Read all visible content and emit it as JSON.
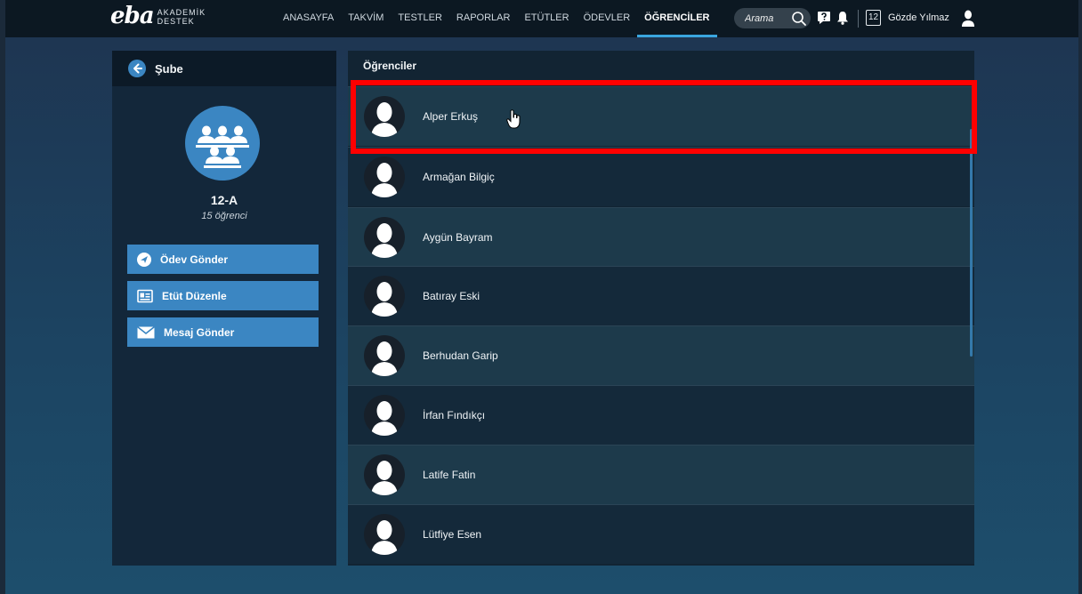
{
  "header": {
    "logo_mark": "eba",
    "logo_line1": "AKADEMİK",
    "logo_line2": "DESTEK",
    "nav": [
      {
        "label": "ANASAYFA"
      },
      {
        "label": "TAKVİM"
      },
      {
        "label": "TESTLER"
      },
      {
        "label": "RAPORLAR"
      },
      {
        "label": "ETÜTLER"
      },
      {
        "label": "ÖDEVLER"
      },
      {
        "label": "ÖĞRENCİLER",
        "active": true
      }
    ],
    "search_placeholder": "Arama",
    "calendar_day": "12",
    "user_name": "Gözde Yılmaz"
  },
  "sidebar": {
    "back_label": "Şube",
    "class_name": "12-A",
    "student_count": "15 öğrenci",
    "actions": [
      {
        "label": "Ödev Gönder",
        "icon": "send-icon"
      },
      {
        "label": "Etüt Düzenle",
        "icon": "id-card-icon"
      },
      {
        "label": "Mesaj Gönder",
        "icon": "envelope-icon"
      }
    ]
  },
  "students": {
    "title": "Öğrenciler",
    "list": [
      {
        "name": "Alper Erkuş"
      },
      {
        "name": "Armağan Bilgiç"
      },
      {
        "name": "Aygün Bayram"
      },
      {
        "name": "Batıray Eski"
      },
      {
        "name": "Berhudan Garip"
      },
      {
        "name": "İrfan Fındıkçı"
      },
      {
        "name": "Latife Fatin"
      },
      {
        "name": "Lütfiye Esen"
      }
    ]
  },
  "colors": {
    "accent": "#3b86c2",
    "active_tab_underline": "#3aa6df",
    "highlight": "#ff0000"
  }
}
